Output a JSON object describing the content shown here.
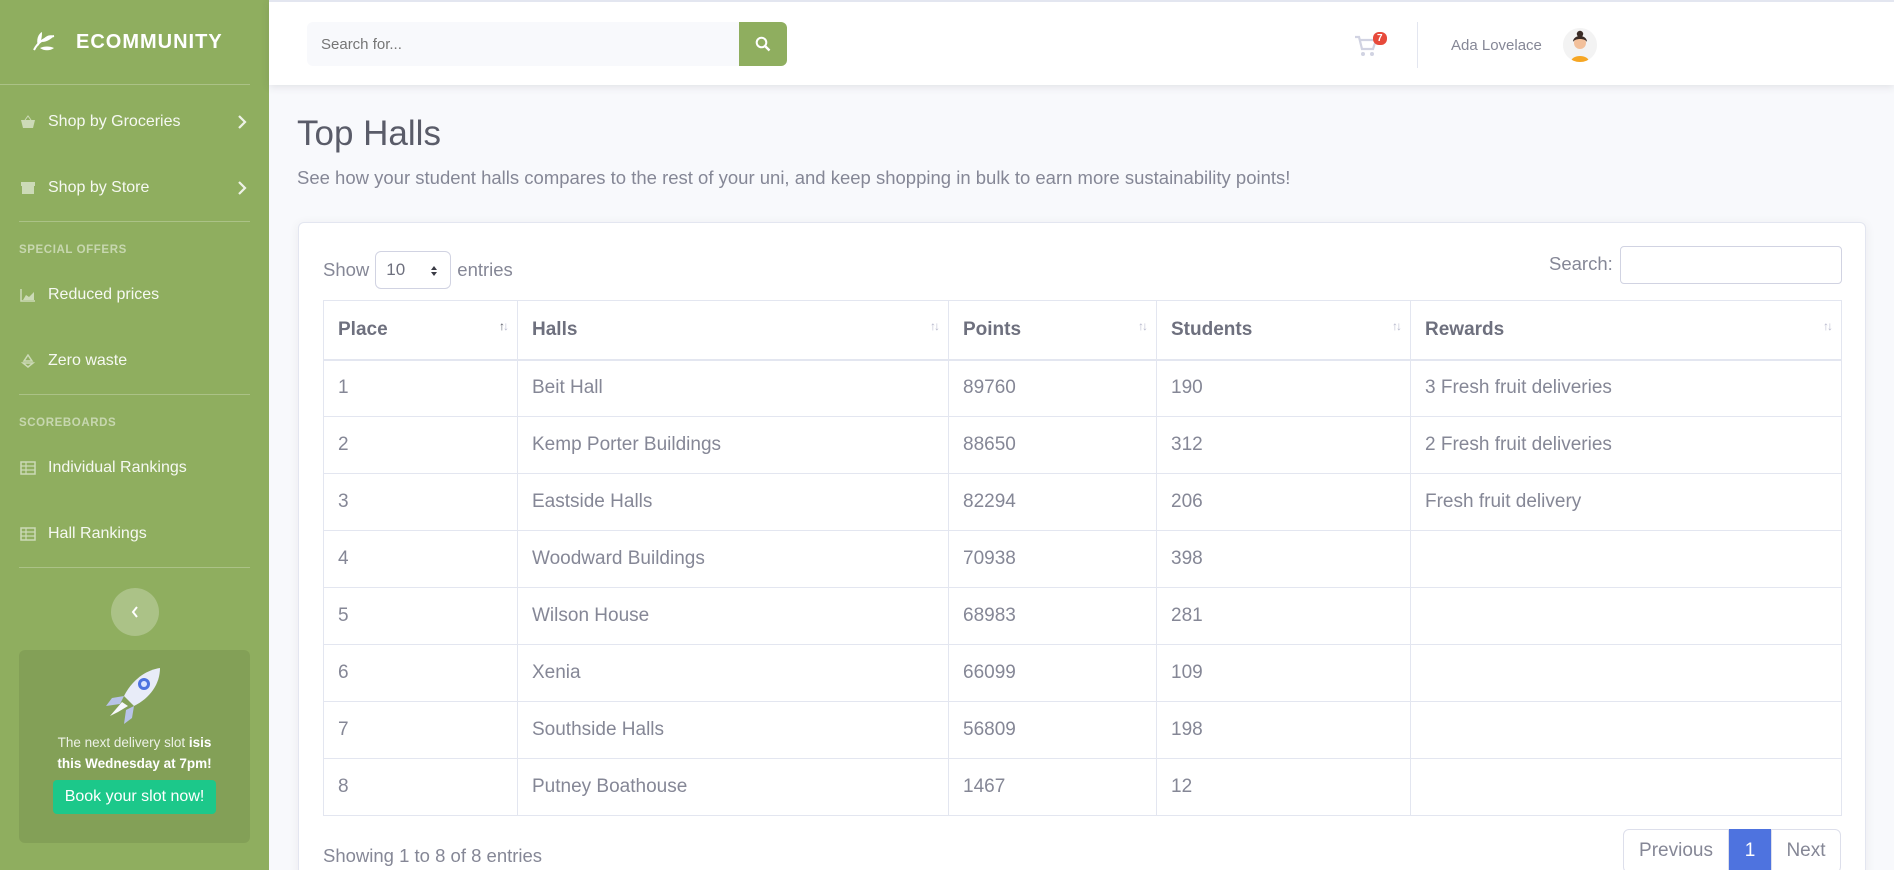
{
  "brand": {
    "name": "ECOMMUNITY"
  },
  "sidebar": {
    "items_top": [
      {
        "label": "Shop by Groceries",
        "icon": "basket-icon"
      },
      {
        "label": "Shop by Store",
        "icon": "store-icon"
      }
    ],
    "heading_offers": "SPECIAL OFFERS",
    "items_offers": [
      {
        "label": "Reduced prices",
        "icon": "chart-area-icon"
      },
      {
        "label": "Zero waste",
        "icon": "recycle-icon"
      }
    ],
    "heading_scoreboards": "SCOREBOARDS",
    "items_scoreboards": [
      {
        "label": "Individual Rankings",
        "icon": "table-icon"
      },
      {
        "label": "Hall Rankings",
        "icon": "table-icon"
      }
    ],
    "promo": {
      "text_plain": "The next delivery slot is",
      "text_bold_1": "is",
      "text_bold_2": "this Wednesday at 7pm!",
      "button": "Book your slot now!"
    }
  },
  "topbar": {
    "search_placeholder": "Search for...",
    "cart_count": "7",
    "user_name": "Ada Lovelace"
  },
  "main": {
    "title": "Top Halls",
    "description": "See how your student halls compares to the rest of your uni, and keep shopping in bulk to earn more sustainability points!",
    "show_label": "Show",
    "entries_label": "entries",
    "page_size": "10",
    "search_label": "Search:",
    "columns": [
      "Place",
      "Halls",
      "Points",
      "Students",
      "Rewards"
    ],
    "rows": [
      [
        "1",
        "Beit Hall",
        "89760",
        "190",
        "3 Fresh fruit deliveries"
      ],
      [
        "2",
        "Kemp Porter Buildings",
        "88650",
        "312",
        "2 Fresh fruit deliveries"
      ],
      [
        "3",
        "Eastside Halls",
        "82294",
        "206",
        "Fresh fruit delivery"
      ],
      [
        "4",
        "Woodward Buildings",
        "70938",
        "398",
        ""
      ],
      [
        "5",
        "Wilson House",
        "68983",
        "281",
        ""
      ],
      [
        "6",
        "Xenia",
        "66099",
        "109",
        ""
      ],
      [
        "7",
        "Southside Halls",
        "56809",
        "198",
        ""
      ],
      [
        "8",
        "Putney Boathouse",
        "1467",
        "12",
        ""
      ]
    ],
    "info": "Showing 1 to 8 of 8 entries",
    "pager": {
      "previous": "Previous",
      "current": "1",
      "next": "Next"
    }
  },
  "colors": {
    "sidebar": "#8fae5f",
    "primary": "#4e73df",
    "success": "#1cc88a",
    "danger": "#e74a3b"
  }
}
